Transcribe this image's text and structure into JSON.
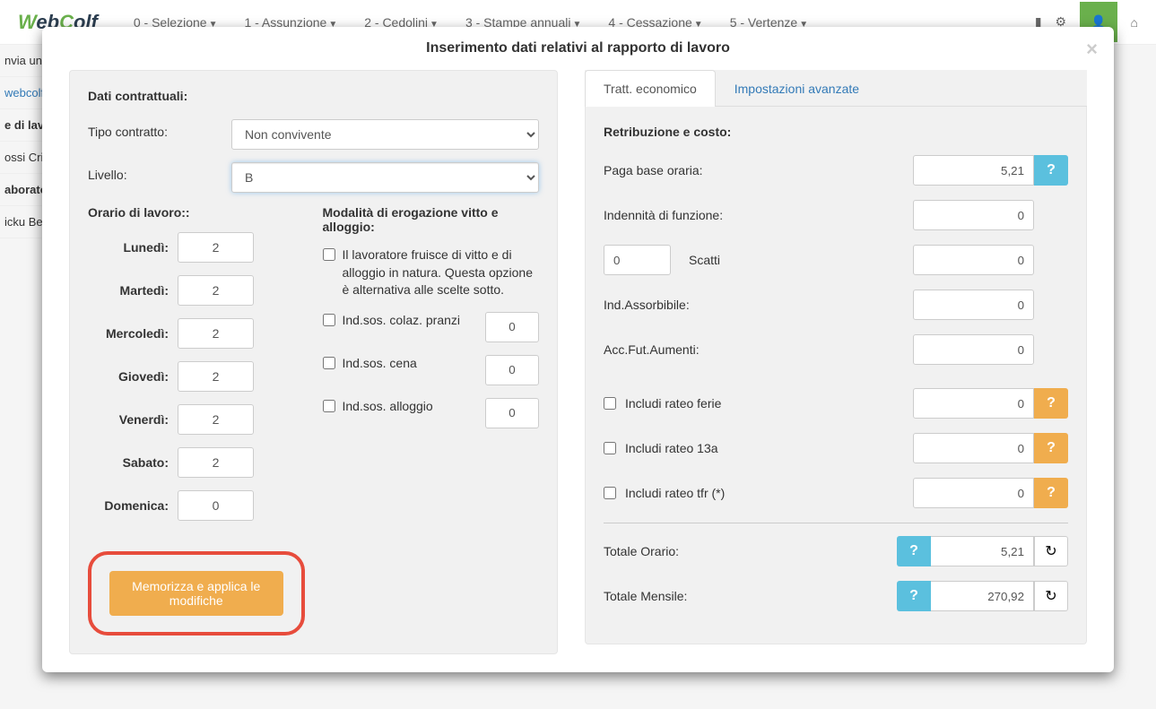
{
  "bg": {
    "nav": [
      "0 - Selezione",
      "1 - Assunzione",
      "2 - Cedolini",
      "3 - Stampe annuali",
      "4 - Cessazione",
      "5 - Vertenze"
    ],
    "side": {
      "txt1": "nvia un'e",
      "link": "webcolf.",
      "bold1": "e di lav",
      "row1": "ossi Cris",
      "bold2": "aborato",
      "row2": "icku Bea"
    }
  },
  "modal": {
    "title": "Inserimento dati relativi al rapporto di lavoro",
    "close": "×"
  },
  "left": {
    "title": "Dati contrattuali:",
    "tipo_label": "Tipo contratto:",
    "tipo_value": "Non convivente",
    "livello_label": "Livello:",
    "livello_value": "B",
    "orario_title": "Orario di lavoro::",
    "days": {
      "lun": {
        "label": "Lunedì:",
        "val": "2"
      },
      "mar": {
        "label": "Martedì:",
        "val": "2"
      },
      "mer": {
        "label": "Mercoledì:",
        "val": "2"
      },
      "gio": {
        "label": "Giovedì:",
        "val": "2"
      },
      "ven": {
        "label": "Venerdì:",
        "val": "2"
      },
      "sab": {
        "label": "Sabato:",
        "val": "2"
      },
      "dom": {
        "label": "Domenica:",
        "val": "0"
      }
    },
    "vitto_title": "Modalità di erogazione vitto e alloggio:",
    "vitto_check": "Il lavoratore fruisce di vitto e di alloggio in natura. Questa opzione è alternativa alle scelte sotto.",
    "ind_colaz": {
      "label": "Ind.sos. colaz. pranzi",
      "val": "0"
    },
    "ind_cena": {
      "label": "Ind.sos. cena",
      "val": "0"
    },
    "ind_alloggio": {
      "label": "Ind.sos. alloggio",
      "val": "0"
    },
    "save_btn": "Memorizza e applica le modifiche"
  },
  "right": {
    "tab1": "Tratt. economico",
    "tab2": "Impostazioni avanzate",
    "title": "Retribuzione e costo:",
    "paga": {
      "label": "Paga base oraria:",
      "val": "5,21"
    },
    "indennita": {
      "label": "Indennità di funzione:",
      "val": "0"
    },
    "scatti": {
      "label": "Scatti",
      "count": "0",
      "val": "0"
    },
    "assorbibile": {
      "label": "Ind.Assorbibile:",
      "val": "0"
    },
    "accfut": {
      "label": "Acc.Fut.Aumenti:",
      "val": "0"
    },
    "rateo_ferie": {
      "label": "Includi rateo ferie",
      "val": "0"
    },
    "rateo_13a": {
      "label": "Includi rateo 13a",
      "val": "0"
    },
    "rateo_tfr": {
      "label": "Includi rateo tfr (*)",
      "val": "0"
    },
    "tot_orario": {
      "label": "Totale Orario:",
      "val": "5,21"
    },
    "tot_mensile": {
      "label": "Totale Mensile:",
      "val": "270,92"
    }
  }
}
